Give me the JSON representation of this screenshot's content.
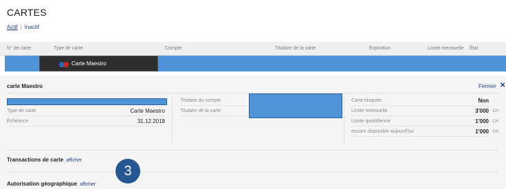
{
  "page": {
    "title": "CARTES"
  },
  "status_tabs": {
    "active": "Actif",
    "separator": "|",
    "inactive": "Inactif"
  },
  "table": {
    "headers": [
      "N° de carte",
      "Type de carte",
      "Compte",
      "Titulaire de la carte",
      "Expiration",
      "Limite mensuelle",
      "État"
    ],
    "row": {
      "card_type": "Carte Maestro"
    }
  },
  "details": {
    "title": "carte Maestro",
    "close_label": "Fermer",
    "close_icon": "✕",
    "left": [
      {
        "label": "Type de carte",
        "value": "Carte Maestro"
      },
      {
        "label": "Échéance",
        "value": "31.12.2018"
      }
    ],
    "middle": [
      {
        "label": "Titulaire du compte"
      },
      {
        "label": "Titulaire de la carte"
      }
    ],
    "right": [
      {
        "label": "Carte bloquée",
        "value": "Non"
      },
      {
        "label": "Limite mensuelle",
        "value": "3'000",
        "unit": "CH"
      },
      {
        "label": "Limite quotidienne",
        "value": "1'000",
        "unit": "CH"
      },
      {
        "label": "encore disponible aujourd'hui",
        "value": "1'000",
        "unit": "CH"
      }
    ]
  },
  "sections": [
    {
      "title": "Transactions de carte",
      "link": "afficher"
    },
    {
      "title": "Autorisation géographique",
      "link": "afficher"
    }
  ],
  "annotation": {
    "step": "3"
  },
  "colors": {
    "redaction": "#4f93d8",
    "link": "#1a3e8f",
    "badge": "#245693"
  }
}
